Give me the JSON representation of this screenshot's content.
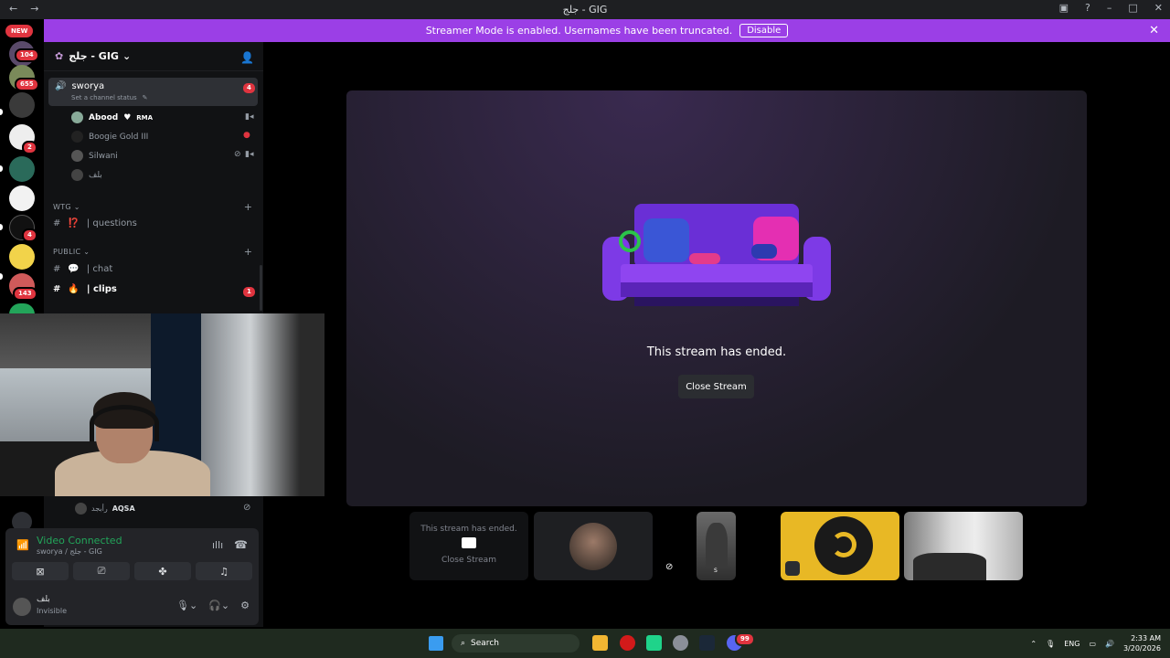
{
  "window": {
    "title": "جلج - GIG",
    "nav_back": "←",
    "nav_forward": "→"
  },
  "banner": {
    "text": "Streamer Mode is enabled. Usernames have been truncated.",
    "button": "Disable"
  },
  "servers": {
    "new_label": "NEW",
    "badges": [
      "104",
      "655",
      "2",
      "4",
      "143"
    ]
  },
  "guild": {
    "name": "جلج - GIG"
  },
  "voice_channel": {
    "name": "sworya",
    "status_placeholder": "Set a channel status",
    "badge": "4",
    "members": [
      {
        "name": "Abood",
        "tag": "RMA"
      },
      {
        "name": "Boogie Gold III"
      },
      {
        "name": "Silwani"
      },
      {
        "name": "بلف"
      }
    ]
  },
  "categories": [
    {
      "name": "WTG",
      "channels": [
        {
          "name": "| questions",
          "emoji": "⁉️"
        }
      ]
    },
    {
      "name": "PUBLIC",
      "channels": [
        {
          "name": "| chat",
          "emoji": "💬"
        },
        {
          "name": "| clips",
          "emoji": "🔥",
          "badge": "1"
        }
      ]
    }
  ],
  "self_video_user": {
    "name": "AQSA",
    "prefix": "رأبجد"
  },
  "voice_panel": {
    "status": "Video Connected",
    "sub": "sworya / جلج - GIG",
    "user_name": "بلف",
    "user_status": "Invisible"
  },
  "stage": {
    "ended_text": "This stream has ended.",
    "close_button": "Close Stream"
  },
  "tiles": {
    "t1_text": "This stream has ended.",
    "t1_button": "Close Stream",
    "t3_label": "S"
  },
  "taskbar": {
    "search": "Search",
    "lang": "ENG",
    "time": "2:33 AM",
    "date": "3/20/2026",
    "discord_badge": "99"
  },
  "colors": {
    "accent": "#9b3fe6",
    "green": "#23a55a",
    "red": "#e0343f"
  }
}
